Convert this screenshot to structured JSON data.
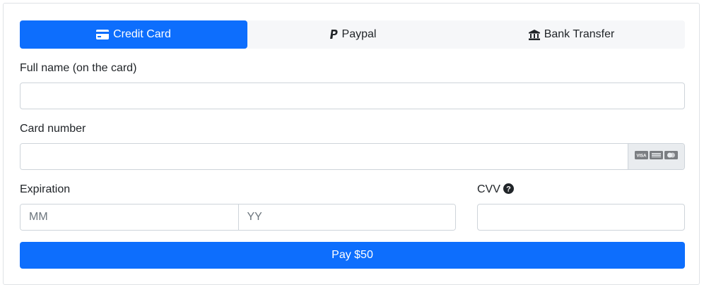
{
  "tabs": [
    {
      "label": "Credit Card",
      "icon": "credit-card-icon",
      "active": true
    },
    {
      "label": "Paypal",
      "icon": "paypal-icon",
      "active": false
    },
    {
      "label": "Bank Transfer",
      "icon": "bank-icon",
      "active": false
    }
  ],
  "form": {
    "full_name": {
      "label": "Full name (on the card)",
      "value": "",
      "placeholder": ""
    },
    "card_number": {
      "label": "Card number",
      "value": "",
      "placeholder": "",
      "card_brands": [
        "visa",
        "amex",
        "mastercard"
      ]
    },
    "expiration": {
      "label": "Expiration",
      "month_placeholder": "MM",
      "year_placeholder": "YY"
    },
    "cvv": {
      "label": "CVV",
      "help_icon": "question-circle-icon",
      "value": "",
      "placeholder": ""
    }
  },
  "submit": {
    "label": "Pay $50"
  },
  "colors": {
    "primary": "#0d6efd",
    "tab_bg": "#f6f7f9",
    "addon_bg": "#e9ecef",
    "border": "#ced4da"
  }
}
